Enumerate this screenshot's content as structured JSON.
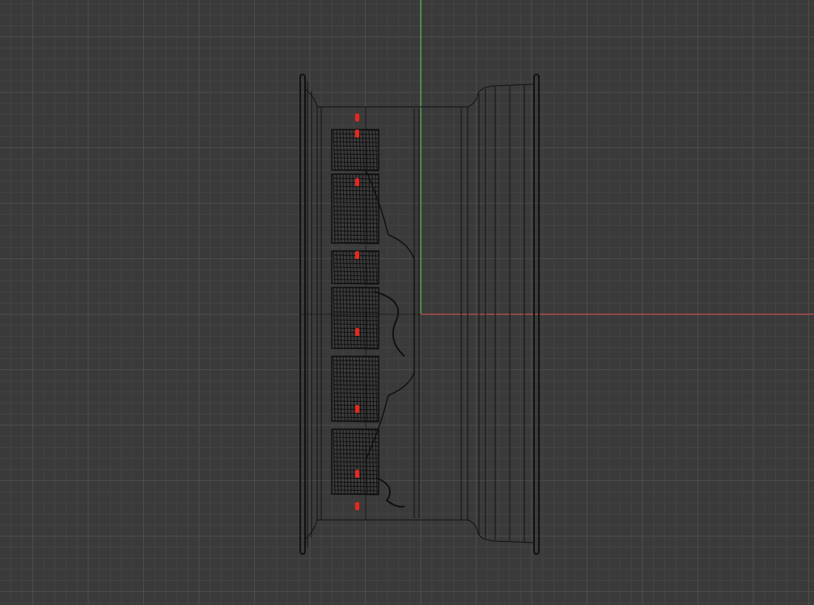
{
  "viewport": {
    "background": "#3a3a3a",
    "grid_minor_color": "#444444",
    "grid_major_color": "#4d4d4d",
    "axis_x_color": "#c0504d",
    "axis_y_color": "#5fbf5f",
    "wire_color": "#111111",
    "marker_color": "#e8281e"
  },
  "object": {
    "name": "",
    "type": "wheel-rim-wireframe"
  }
}
